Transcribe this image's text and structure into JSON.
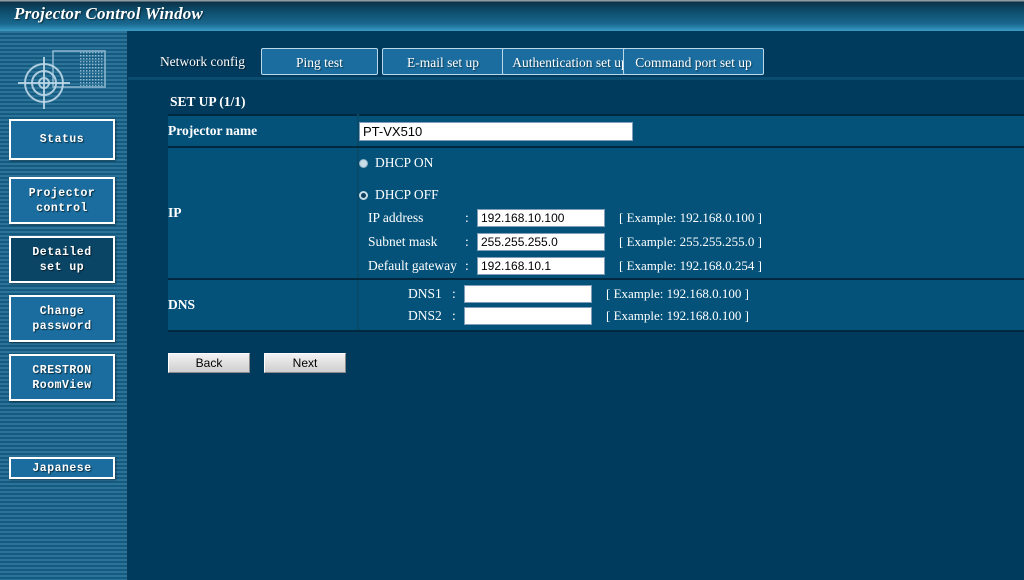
{
  "window": {
    "title": "Projector Control Window"
  },
  "sidebar": {
    "logo_icon": "projector-target-logo",
    "buttons": [
      {
        "id": "status",
        "label": "Status",
        "active": false
      },
      {
        "id": "projector-control",
        "label": "Projector\ncontrol",
        "active": false
      },
      {
        "id": "detailed-set-up",
        "label": "Detailed\nset up",
        "active": true
      },
      {
        "id": "change-password",
        "label": "Change\npassword",
        "active": false
      },
      {
        "id": "crestron-roomview",
        "label": "CRESTRON\nRoomView",
        "active": false
      }
    ],
    "language_button": {
      "id": "japanese",
      "label": "Japanese"
    }
  },
  "tabs": [
    {
      "id": "network-config",
      "label": "Network config",
      "active": true
    },
    {
      "id": "ping-test",
      "label": "Ping test",
      "active": false
    },
    {
      "id": "email-set-up",
      "label": "E-mail set up",
      "active": false
    },
    {
      "id": "authentication-set-up",
      "label": "Authentication set up",
      "active": false
    },
    {
      "id": "command-port-set-up",
      "label": "Command port set up",
      "active": false
    }
  ],
  "main": {
    "heading": "SET UP (1/1)",
    "rows": {
      "projector_name": {
        "label": "Projector name",
        "value": "PT-VX510",
        "placeholder": ""
      },
      "ip": {
        "label": "IP",
        "dhcp_on": {
          "label": "DHCP ON",
          "selected": false
        },
        "dhcp_off": {
          "label": "DHCP OFF",
          "selected": true
        },
        "fields": [
          {
            "id": "ip-address",
            "label": "IP address",
            "colon": ":",
            "value": "192.168.10.100",
            "example": "[ Example: 192.168.0.100 ]"
          },
          {
            "id": "subnet-mask",
            "label": "Subnet mask",
            "colon": ":",
            "value": "255.255.255.0",
            "example": "[ Example: 255.255.255.0 ]"
          },
          {
            "id": "default-gateway",
            "label": "Default gateway",
            "colon": ":",
            "value": "192.168.10.1",
            "example": "[ Example: 192.168.0.254 ]"
          }
        ]
      },
      "dns": {
        "label": "DNS",
        "fields": [
          {
            "id": "dns1",
            "label": "DNS1",
            "colon": ":",
            "value": "",
            "example": "[ Example: 192.168.0.100 ]"
          },
          {
            "id": "dns2",
            "label": "DNS2",
            "colon": ":",
            "value": "",
            "example": "[ Example: 192.168.0.100 ]"
          }
        ]
      }
    },
    "buttons": [
      {
        "id": "back",
        "label": "Back"
      },
      {
        "id": "next",
        "label": "Next"
      }
    ]
  },
  "colors": {
    "title_bar_accent": "#3e9cc4",
    "sidebar": "#17658f",
    "content_bg": "#003a5c",
    "row_bg": "#045279",
    "tab_inactive": "#1a6d9e",
    "text": "#ffffff"
  }
}
